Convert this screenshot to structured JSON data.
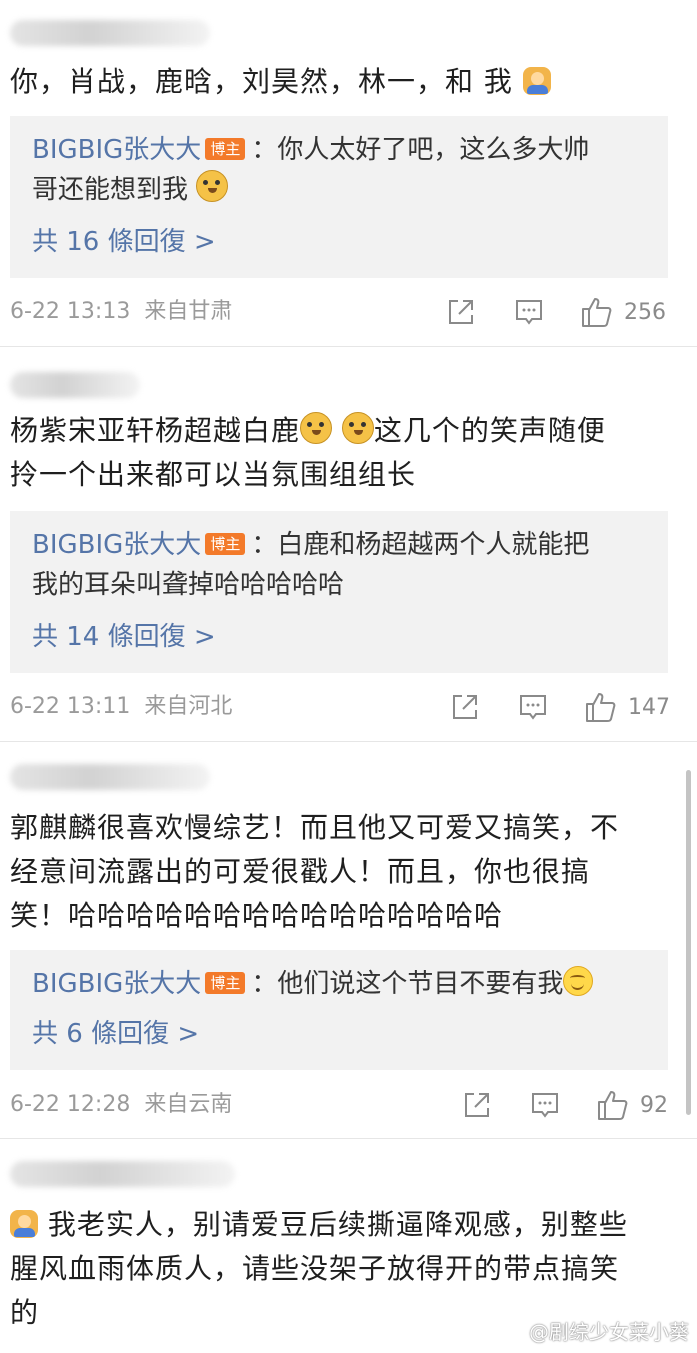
{
  "comments": [
    {
      "text": "你，肖战，鹿晗，刘昊然，林一，和 我",
      "reply": {
        "author": "BIGBIG张大大",
        "badge": "博主",
        "text_1": "：你人太好了吧，这么多大帅",
        "text_2": "哥还能想到我"
      },
      "reply_count": "共 16 條回復 >",
      "time": "6-22 13:13",
      "location": "来自甘肃",
      "likes": "256"
    },
    {
      "text_1": "杨紫宋亚轩杨超越白鹿",
      "text_1b": "这几个的笑声随便",
      "text_2": "拎一个出来都可以当氛围组组长",
      "reply": {
        "author": "BIGBIG张大大",
        "badge": "博主",
        "text_1": "：白鹿和杨超越两个人就能把",
        "text_2": "我的耳朵叫聋掉哈哈哈哈哈"
      },
      "reply_count": "共 14 條回復 >",
      "time": "6-22 13:11",
      "location": "来自河北",
      "likes": "147"
    },
    {
      "text_1": "郭麒麟很喜欢慢综艺！而且他又可爱又搞笑，不",
      "text_2": "经意间流露出的可爱很戳人！而且，你也很搞",
      "text_3": "笑！哈哈哈哈哈哈哈哈哈哈哈哈哈哈哈",
      "reply": {
        "author": "BIGBIG张大大",
        "badge": "博主",
        "text_1": "：他们说这个节目不要有我"
      },
      "reply_count": "共 6 條回復 >",
      "time": "6-22 12:28",
      "location": "来自云南",
      "likes": "92"
    },
    {
      "text_1": "我老实人，别请爱豆后续撕逼降观感，别整些",
      "text_2": "腥风血雨体质人，请些没架子放得开的带点搞笑",
      "text_3": "的"
    }
  ],
  "watermark": "@剧综少女菜小葵",
  "icons": {
    "share": "share-icon",
    "comment": "comment-icon",
    "like": "like-icon"
  },
  "colors": {
    "author": "#5575a8",
    "badge": "#f37a2a",
    "reply_bg": "#f2f2f2"
  }
}
